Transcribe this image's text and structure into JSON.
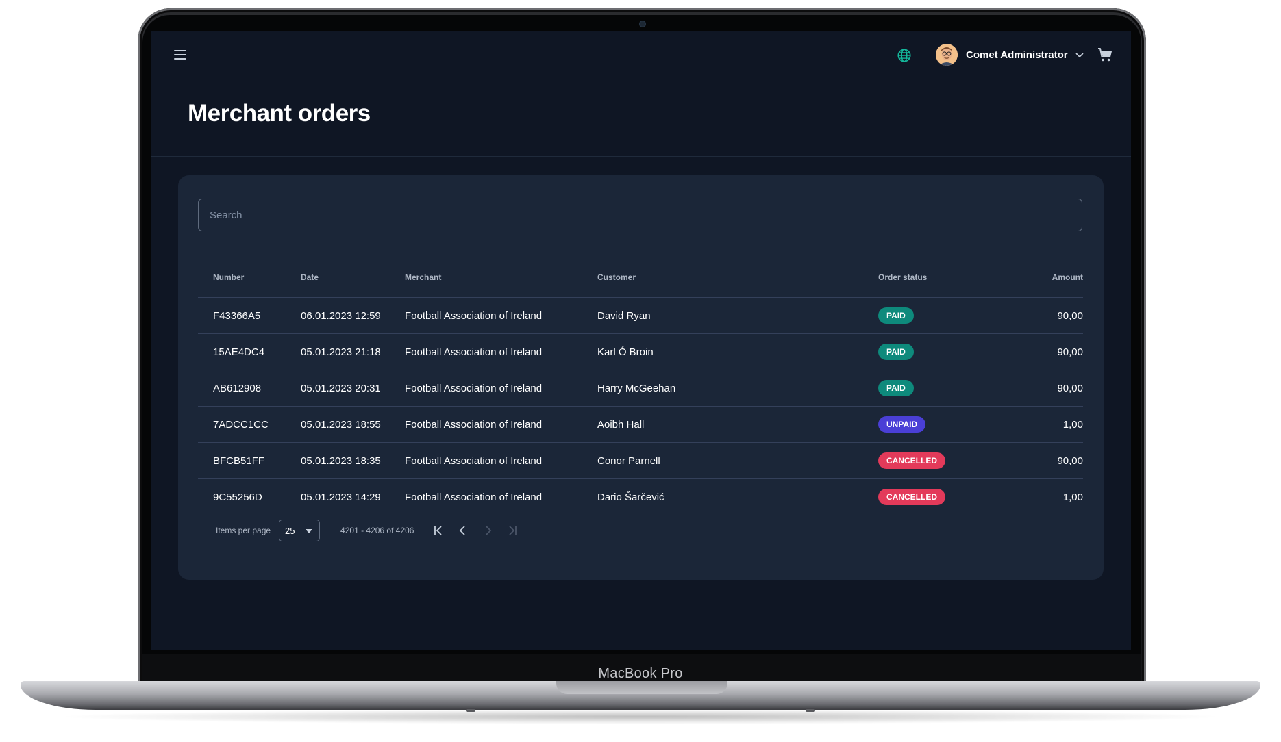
{
  "device": {
    "brand_label": "MacBook Pro"
  },
  "topbar": {
    "user_name": "Comet Administrator",
    "icons": [
      "menu-icon",
      "globe-icon",
      "avatar",
      "chevron-down-icon",
      "cart-icon"
    ]
  },
  "page": {
    "title": "Merchant orders"
  },
  "search": {
    "placeholder": "Search",
    "value": ""
  },
  "table": {
    "columns": {
      "number": "Number",
      "date": "Date",
      "merchant": "Merchant",
      "customer": "Customer",
      "status": "Order status",
      "amount": "Amount"
    },
    "rows": [
      {
        "number": "F43366A5",
        "date": "06.01.2023 12:59",
        "merchant": "Football Association of Ireland",
        "customer": "David Ryan",
        "status": "PAID",
        "amount": "90,00"
      },
      {
        "number": "15AE4DC4",
        "date": "05.01.2023 21:18",
        "merchant": "Football Association of Ireland",
        "customer": "Karl Ó Broin",
        "status": "PAID",
        "amount": "90,00"
      },
      {
        "number": "AB612908",
        "date": "05.01.2023 20:31",
        "merchant": "Football Association of Ireland",
        "customer": "Harry McGeehan",
        "status": "PAID",
        "amount": "90,00"
      },
      {
        "number": "7ADCC1CC",
        "date": "05.01.2023 18:55",
        "merchant": "Football Association of Ireland",
        "customer": "Aoibh Hall",
        "status": "UNPAID",
        "amount": "1,00"
      },
      {
        "number": "BFCB51FF",
        "date": "05.01.2023 18:35",
        "merchant": "Football Association of Ireland",
        "customer": "Conor Parnell",
        "status": "CANCELLED",
        "amount": "90,00"
      },
      {
        "number": "9C55256D",
        "date": "05.01.2023 14:29",
        "merchant": "Football Association of Ireland",
        "customer": "Dario Šarčević",
        "status": "CANCELLED",
        "amount": "1,00"
      }
    ]
  },
  "status_colors": {
    "PAID": "#0e8a7c",
    "UNPAID": "#4a3fd6",
    "CANCELLED": "#e33a5a"
  },
  "pagination": {
    "items_per_page_label": "Items per page",
    "page_size": "25",
    "range_label": "4201 - 4206 of 4206",
    "buttons": [
      "first-page-icon",
      "previous-page-icon",
      "next-page-icon",
      "last-page-icon"
    ]
  },
  "colors": {
    "accent": "#14b89c",
    "screen_background": "#0f1624",
    "card_background": "#1b2638"
  }
}
